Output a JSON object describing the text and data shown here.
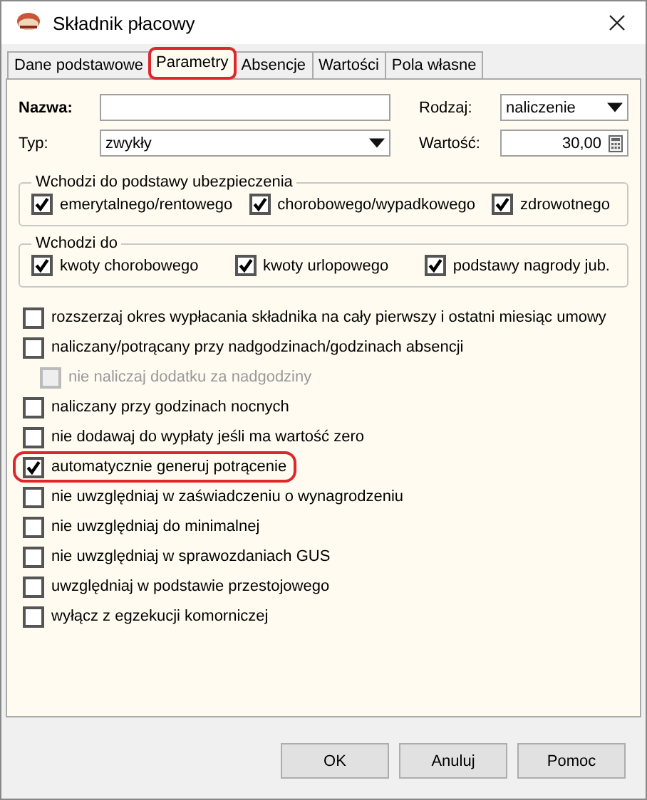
{
  "window": {
    "title": "Składnik płacowy"
  },
  "tabs": [
    {
      "label": "Dane podstawowe",
      "selected": false,
      "highlighted": false
    },
    {
      "label": "Parametry",
      "selected": true,
      "highlighted": true
    },
    {
      "label": "Absencje",
      "selected": false,
      "highlighted": false
    },
    {
      "label": "Wartości",
      "selected": false,
      "highlighted": false
    },
    {
      "label": "Pola własne",
      "selected": false,
      "highlighted": false
    }
  ],
  "fields": {
    "name": {
      "label": "Nazwa:"
    },
    "type": {
      "label": "Typ:",
      "value": "zwykły"
    },
    "kind": {
      "label": "Rodzaj:",
      "value": "naliczenie"
    },
    "amount": {
      "label": "Wartość:",
      "value": "30,00"
    }
  },
  "groups": [
    {
      "title": "Wchodzi do podstawy ubezpieczenia",
      "items": [
        {
          "label": "emerytalnego/rentowego",
          "checked": true
        },
        {
          "label": "chorobowego/wypadkowego",
          "checked": true
        },
        {
          "label": "zdrowotnego",
          "checked": true
        }
      ]
    },
    {
      "title": "Wchodzi do",
      "items": [
        {
          "label": "kwoty chorobowego",
          "checked": true
        },
        {
          "label": "kwoty urlopowego",
          "checked": true
        },
        {
          "label": "podstawy nagrody jub.",
          "checked": true
        }
      ]
    }
  ],
  "options": [
    {
      "label": "rozszerzaj okres wypłacania składnika na cały pierwszy i ostatni miesiąc umowy",
      "checked": false,
      "disabled": false,
      "highlighted": false
    },
    {
      "label": "naliczany/potrącany przy nadgodzinach/godzinach absencji",
      "checked": false,
      "disabled": false,
      "highlighted": false,
      "children": [
        {
          "label": "nie naliczaj dodatku za nadgodziny",
          "checked": false,
          "disabled": true,
          "highlighted": false
        }
      ]
    },
    {
      "label": "naliczany przy godzinach nocnych",
      "checked": false,
      "disabled": false,
      "highlighted": false
    },
    {
      "label": "nie dodawaj do wypłaty jeśli ma wartość zero",
      "checked": false,
      "disabled": false,
      "highlighted": false
    },
    {
      "label": "automatycznie generuj potrącenie",
      "checked": true,
      "disabled": false,
      "highlighted": true
    },
    {
      "label": "nie uwzględniaj w zaświadczeniu o wynagrodzeniu",
      "checked": false,
      "disabled": false,
      "highlighted": false
    },
    {
      "label": "nie uwzględniaj do minimalnej",
      "checked": false,
      "disabled": false,
      "highlighted": false
    },
    {
      "label": "nie uwzględniaj w sprawozdaniach GUS",
      "checked": false,
      "disabled": false,
      "highlighted": false
    },
    {
      "label": "uwzględniaj w podstawie przestojowego",
      "checked": false,
      "disabled": false,
      "highlighted": false
    },
    {
      "label": "wyłącz z egzekucji komorniczej",
      "checked": false,
      "disabled": false,
      "highlighted": false
    }
  ],
  "buttons": [
    "OK",
    "Anuluj",
    "Pomoc"
  ]
}
